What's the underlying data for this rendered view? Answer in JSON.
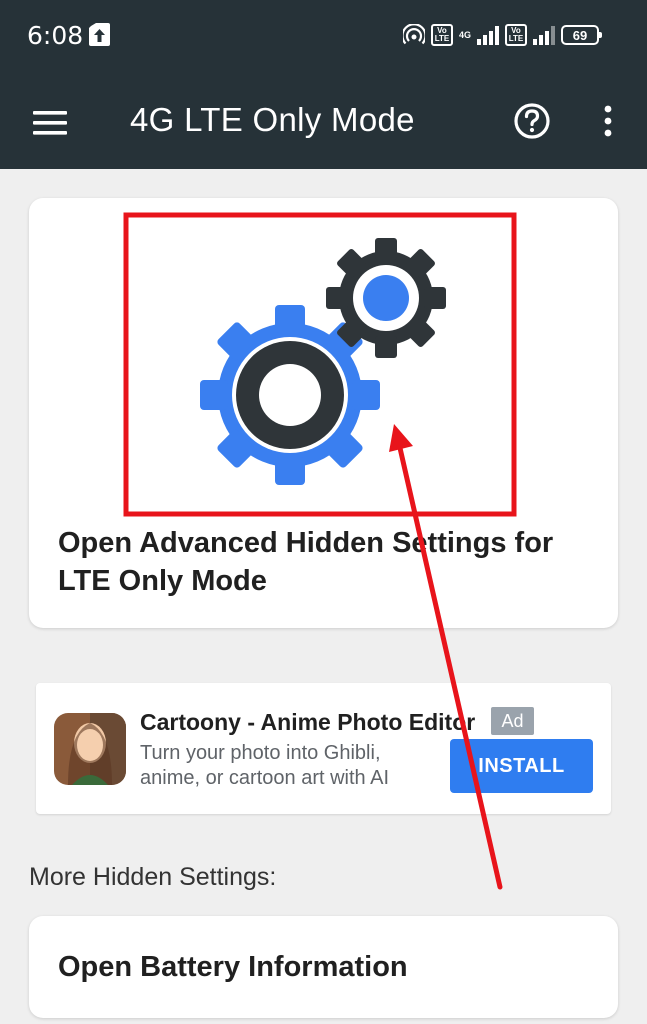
{
  "status_bar": {
    "time": "6:08",
    "network": "4G",
    "volte": "Vo LTE",
    "battery": "69"
  },
  "app_bar": {
    "title": "4G LTE Only Mode",
    "icons": [
      "menu-icon",
      "help-icon",
      "more-vert-icon"
    ]
  },
  "main_card": {
    "text": "Open Advanced Hidden Settings for LTE Only Mode",
    "icon": "gears-icon"
  },
  "ad": {
    "title": "Cartoony - Anime Photo Editor",
    "badge": "Ad",
    "description": "Turn your photo into Ghibli, anime, or cartoon art with AI",
    "button": "INSTALL"
  },
  "more_section": {
    "label": "More Hidden Settings:"
  },
  "battery_card": {
    "text": "Open Battery Information"
  },
  "colors": {
    "appbar": "#263238",
    "accent": "#2f7df0",
    "gear_blue": "#3a7ff0",
    "gear_dark": "#2f3539",
    "highlight": "#e8141b"
  }
}
